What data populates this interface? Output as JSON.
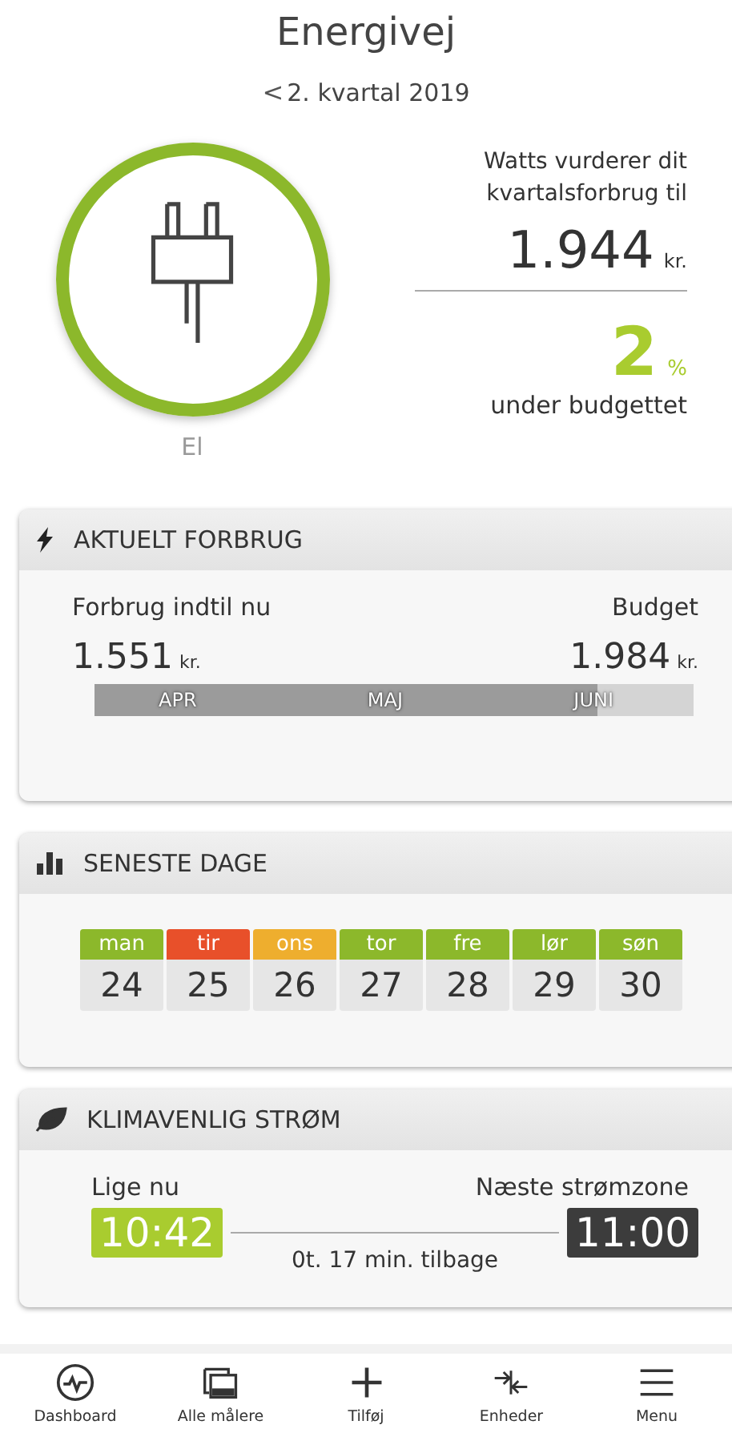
{
  "header": {
    "title": "Energivej",
    "period_back": "<",
    "period": "2. kvartal 2019"
  },
  "summary": {
    "meter_label": "El",
    "estimate_label": "Watts vurderer dit kvartalsforbrug til",
    "estimate_value": "1.944",
    "estimate_unit": "kr.",
    "percent": "2",
    "percent_unit": "%",
    "percent_label": "under budgettet"
  },
  "current_usage": {
    "title": "AKTUELT FORBRUG",
    "used_label": "Forbrug indtil nu",
    "used_value": "1.551",
    "used_unit": "kr.",
    "budget_label": "Budget",
    "budget_value": "1.984",
    "budget_unit": "kr.",
    "level": 0.84,
    "months": [
      "APR",
      "MAJ",
      "JUNI"
    ]
  },
  "recent_days": {
    "title": "SENESTE DAGE",
    "days": [
      {
        "day": "man",
        "date": "24",
        "color": "#8cb82b"
      },
      {
        "day": "tir",
        "date": "25",
        "color": "#e8502a"
      },
      {
        "day": "ons",
        "date": "26",
        "color": "#eeae2e"
      },
      {
        "day": "tor",
        "date": "27",
        "color": "#8cb82b"
      },
      {
        "day": "fre",
        "date": "28",
        "color": "#8cb82b"
      },
      {
        "day": "lør",
        "date": "29",
        "color": "#8cb82b"
      },
      {
        "day": "søn",
        "date": "30",
        "color": "#8cb82b"
      }
    ]
  },
  "green_power": {
    "title": "KLIMAVENLIG STRØM",
    "now_label": "Lige nu",
    "now_time": "10:42",
    "next_label": "Næste strømzone",
    "next_time": "11:00",
    "remaining": "0t. 17 min. tilbage"
  },
  "tab_bar": [
    {
      "label": "Dashboard",
      "kind": "pulse"
    },
    {
      "label": "Alle målere",
      "kind": "photos"
    },
    {
      "label": "Tilføj",
      "kind": "plus"
    },
    {
      "label": "Enheder",
      "kind": "arrows"
    },
    {
      "label": "Menu",
      "kind": "menu"
    }
  ]
}
